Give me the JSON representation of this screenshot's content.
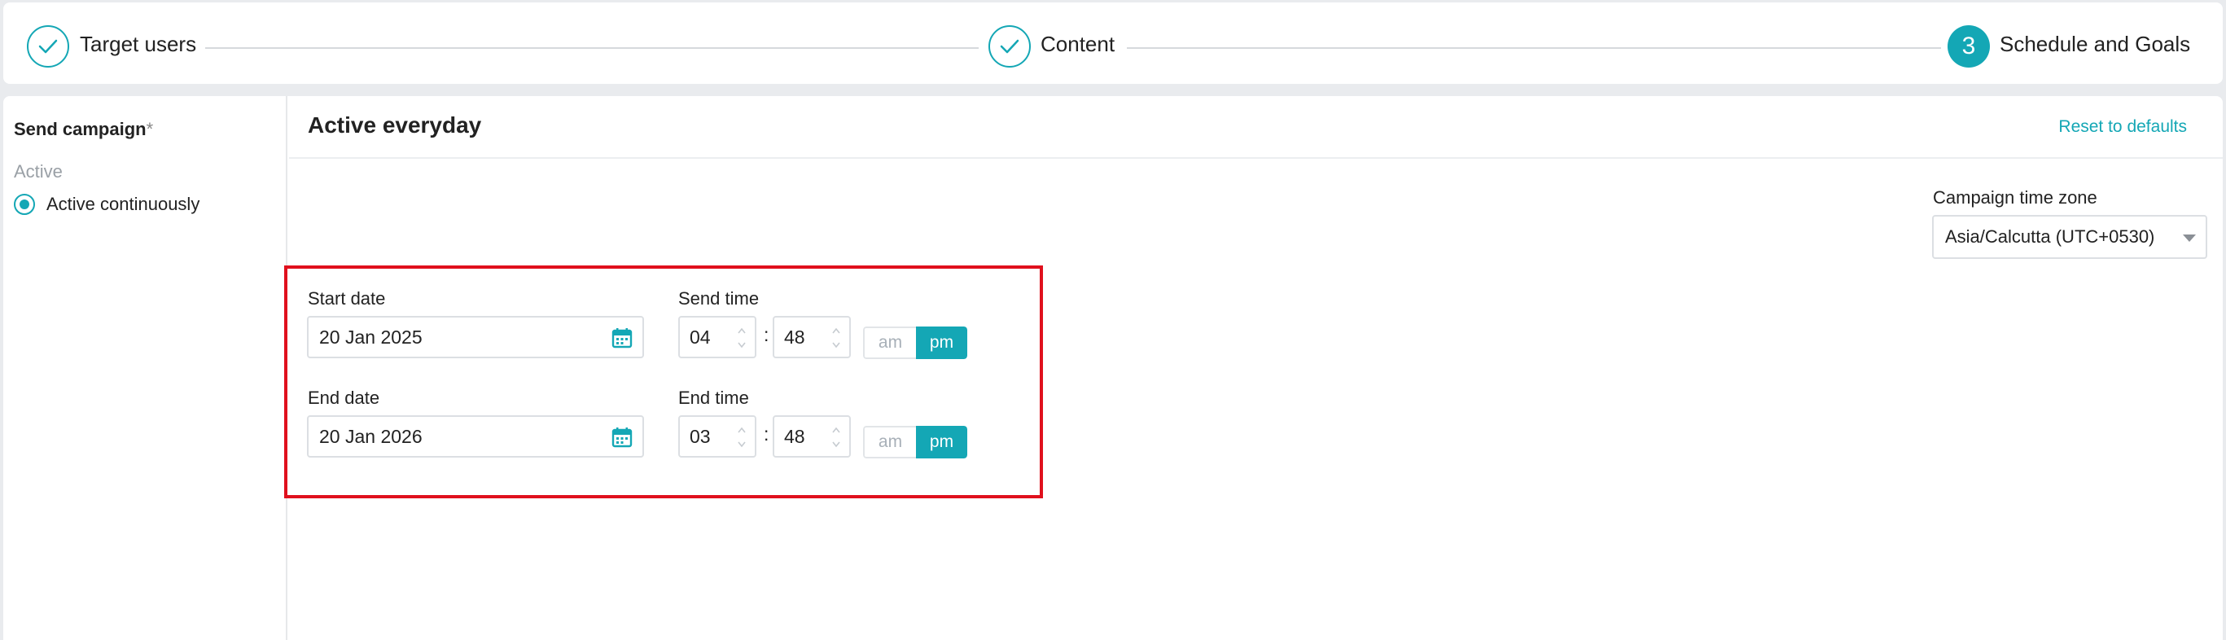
{
  "stepper": {
    "steps": [
      {
        "label": "Target users",
        "status": "done"
      },
      {
        "label": "Content",
        "status": "done"
      },
      {
        "number": "3",
        "label": "Schedule and Goals",
        "status": "active"
      }
    ]
  },
  "sidebar": {
    "title": "Send campaign",
    "required_mark": "*",
    "section": "Active",
    "option": {
      "label": "Active continuously",
      "selected": true
    }
  },
  "main": {
    "title": "Active everyday",
    "reset_link": "Reset to defaults",
    "timezone": {
      "label": "Campaign time zone",
      "value": "Asia/Calcutta (UTC+0530)"
    },
    "start": {
      "date_label": "Start date",
      "date": "20 Jan 2025",
      "time_label": "Send time",
      "hour": "04",
      "minute": "48",
      "am": "am",
      "pm": "pm",
      "period_selected": "pm"
    },
    "end": {
      "date_label": "End date",
      "date": "20 Jan 2026",
      "time_label": "End time",
      "hour": "03",
      "minute": "48",
      "am": "am",
      "pm": "pm",
      "period_selected": "pm"
    }
  },
  "colors": {
    "accent": "#14a7b5",
    "highlight": "#e0101d"
  },
  "icons": [
    "check-icon",
    "calendar-icon",
    "spinner-arrows-icon",
    "dropdown-caret-icon"
  ]
}
